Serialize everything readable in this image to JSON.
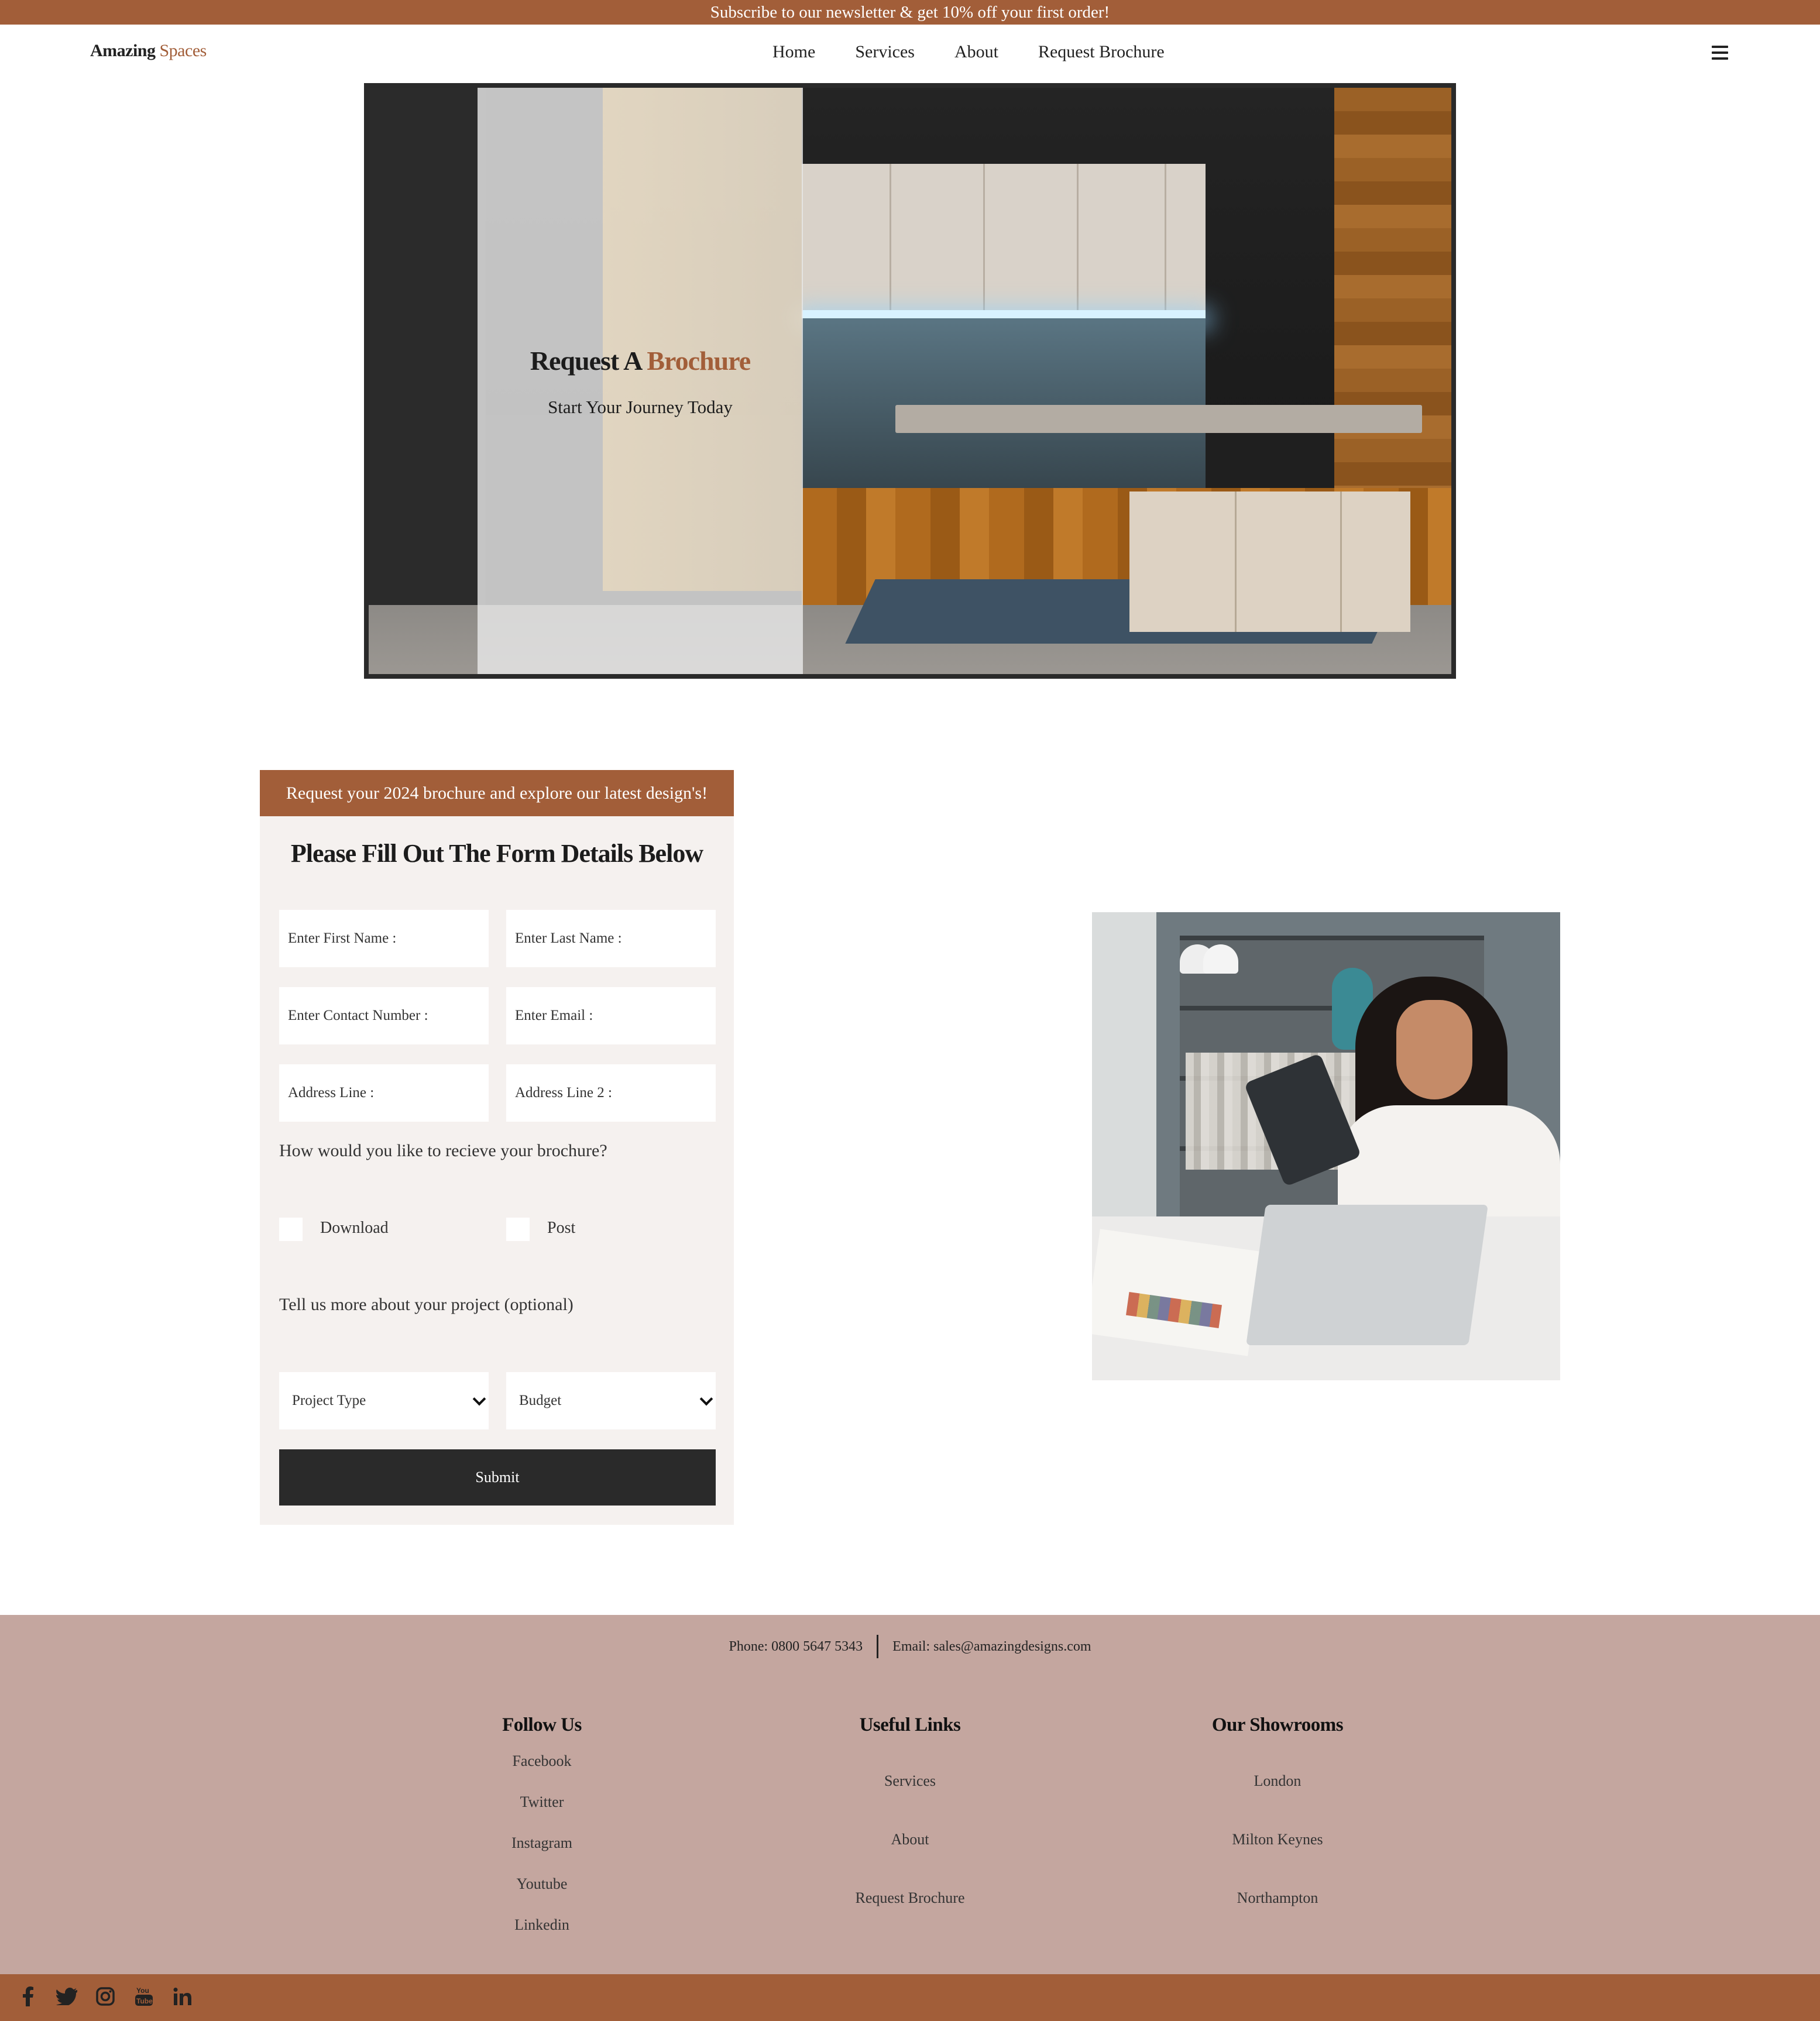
{
  "topbar": {
    "text": "Subscribe to our newsletter & get 10% off your first order!"
  },
  "header": {
    "logo_main": "Amazing",
    "logo_accent": "Spaces",
    "nav": [
      "Home",
      "Services",
      "About",
      "Request Brochure"
    ]
  },
  "hero": {
    "title_main": "Request A",
    "title_accent": "Brochure",
    "subtitle": "Start Your Journey Today"
  },
  "form": {
    "banner": "Request your 2024 brochure and explore our latest design's!",
    "heading": "Please Fill Out The Form Details Below",
    "first_name_placeholder": "Enter First Name :",
    "last_name_placeholder": "Enter Last Name :",
    "contact_placeholder": "Enter Contact Number :",
    "email_placeholder": "Enter Email :",
    "address1_placeholder": "Address Line :",
    "address2_placeholder": "Address Line 2 :",
    "delivery_question": "How would you like to recieve your brochure?",
    "option_download": "Download",
    "option_post": "Post",
    "project_question": "Tell us more about your project (optional)",
    "project_type": "Project Type",
    "budget": "Budget",
    "submit": "Submit"
  },
  "footer": {
    "phone": "Phone: 0800 5647 5343",
    "email": "Email: sales@amazingdesigns.com",
    "follow_title": "Follow Us",
    "follow_links": [
      "Facebook",
      "Twitter",
      "Instagram",
      "Youtube",
      "Linkedin"
    ],
    "useful_title": "Useful Links",
    "useful_links": [
      "Services",
      "About",
      "Request Brochure"
    ],
    "showrooms_title": "Our Showrooms",
    "showrooms": [
      "London",
      "Milton Keynes",
      "Northampton"
    ]
  },
  "social_icons": [
    "facebook-icon",
    "twitter-icon",
    "instagram-icon",
    "youtube-icon",
    "linkedin-icon"
  ],
  "colors": {
    "accent": "#a25e39",
    "footer_bg": "#c4a69f",
    "form_bg": "#f5f1ef",
    "button": "#2a2a2a"
  }
}
